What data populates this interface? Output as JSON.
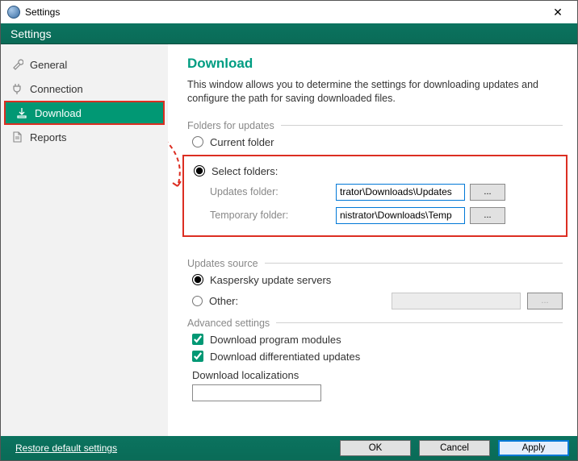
{
  "window": {
    "title": "Settings",
    "header": "Settings"
  },
  "sidebar": {
    "items": [
      {
        "label": "General"
      },
      {
        "label": "Connection"
      },
      {
        "label": "Download"
      },
      {
        "label": "Reports"
      }
    ]
  },
  "download": {
    "title": "Download",
    "description": "This window allows you to determine the settings for downloading updates and configure the path for saving downloaded files.",
    "folders_section": "Folders for updates",
    "current_folder_label": "Current folder",
    "select_folders_label": "Select folders:",
    "updates_label": "Updates folder:",
    "updates_value": "trator\\Downloads\\Updates",
    "temp_label": "Temporary folder:",
    "temp_value": "nistrator\\Downloads\\Temp",
    "browse_label": "...",
    "source_section": "Updates source",
    "source_k": "Kaspersky update servers",
    "source_other": "Other:",
    "advanced_section": "Advanced settings",
    "chk_modules": "Download program modules",
    "chk_diff": "Download differentiated updates",
    "localizations_label": "Download localizations",
    "localizations_value": ""
  },
  "footer": {
    "restore": "Restore default settings",
    "ok": "OK",
    "cancel": "Cancel",
    "apply": "Apply"
  }
}
